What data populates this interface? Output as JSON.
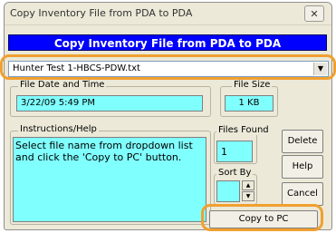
{
  "window": {
    "title": "Copy Inventory File from PDA to PDA",
    "close_icon": "close-icon"
  },
  "banner": {
    "text": "Copy Inventory File from PDA to PDA"
  },
  "file_select": {
    "selected": "Hunter Test 1-HBCS-PDW.txt",
    "arrow_icon": "chevron-down-icon"
  },
  "file_date": {
    "label": "File Date and Time",
    "value": "3/22/09 5:49 PM"
  },
  "file_size": {
    "label": "File Size",
    "value": "1 KB"
  },
  "instructions": {
    "label": "Instructions/Help",
    "text": "Select file name from dropdown list and click the 'Copy to PC' button."
  },
  "files_found": {
    "label": "Files Found",
    "value": "1"
  },
  "sort_by": {
    "label": "Sort By",
    "value": ""
  },
  "buttons": {
    "delete": "Delete",
    "help": "Help",
    "cancel": "Cancel",
    "copy": "Copy to PC"
  },
  "colors": {
    "banner_bg": "#0000ff",
    "field_bg": "#80ffff",
    "highlight": "#f0a030",
    "dialog_bg": "#ece9d8"
  }
}
